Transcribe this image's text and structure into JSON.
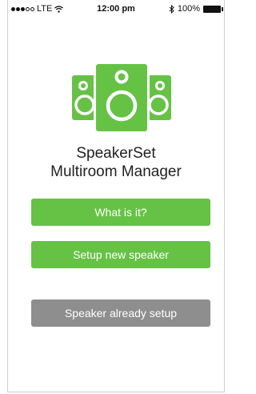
{
  "status_bar": {
    "carrier": "LTE",
    "time": "12:00 pm",
    "battery_percent": "100%",
    "signal_bars_filled": 3,
    "signal_bars_total": 5
  },
  "app": {
    "title_line1": "SpeakerSet",
    "title_line2": "Multiroom Manager"
  },
  "buttons": {
    "what_is_it": "What is it?",
    "setup_new": "Setup new speaker",
    "already_setup": "Speaker already setup"
  },
  "colors": {
    "accent_green": "#66c245",
    "disabled_gray": "#8e8e8e"
  }
}
